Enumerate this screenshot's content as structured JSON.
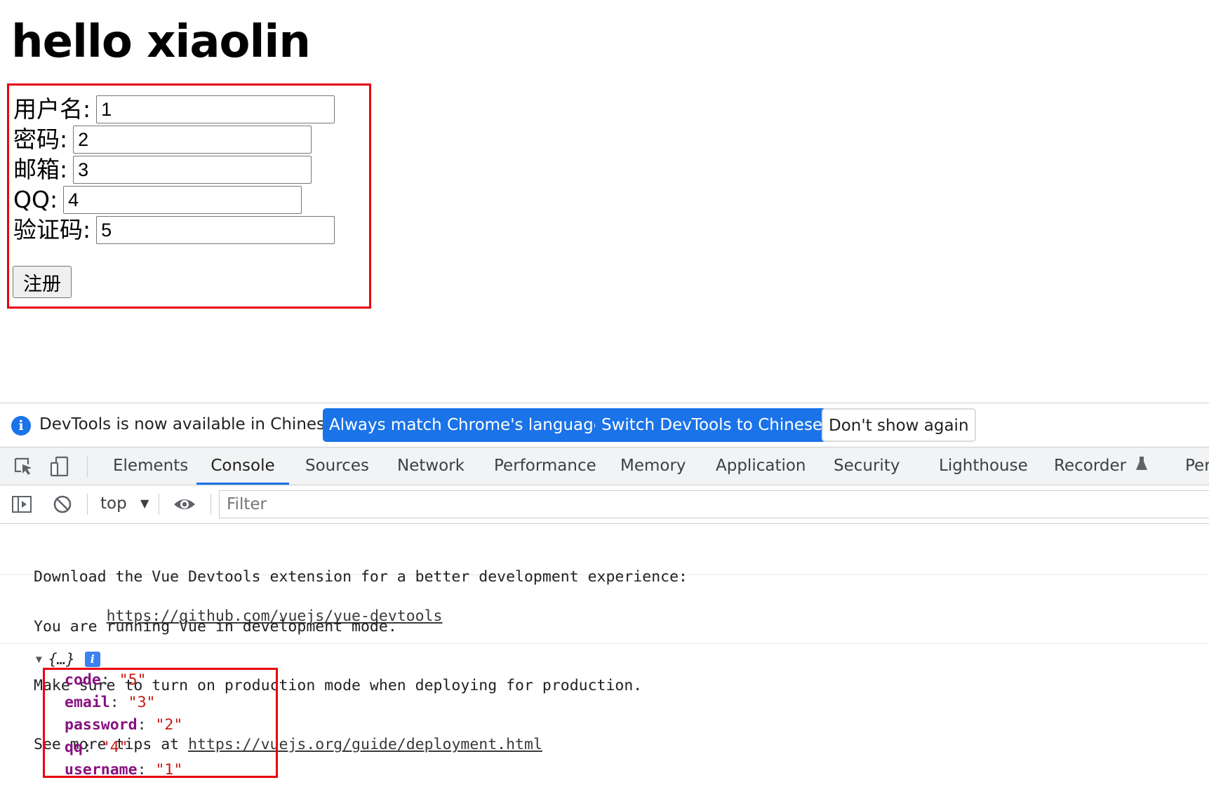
{
  "page": {
    "title": "hello xiaolin",
    "form": {
      "fields": [
        {
          "label": "用户名:",
          "value": "1"
        },
        {
          "label": "密码:",
          "value": "2"
        },
        {
          "label": "邮箱:",
          "value": "3"
        },
        {
          "label": "QQ:",
          "value": "4"
        },
        {
          "label": "验证码:",
          "value": "5"
        }
      ],
      "submit_label": "注册"
    }
  },
  "devtools": {
    "infobar": {
      "message": "DevTools is now available in Chinese!",
      "btn_match": "Always match Chrome's language",
      "btn_switch": "Switch DevTools to Chinese",
      "btn_dismiss": "Don't show again"
    },
    "tabs": [
      "Elements",
      "Console",
      "Sources",
      "Network",
      "Performance",
      "Memory",
      "Application",
      "Security",
      "Lighthouse",
      "Recorder",
      "Per"
    ],
    "active_tab": "Console",
    "toolbar": {
      "context": "top",
      "filter_placeholder": "Filter"
    },
    "console": {
      "messages": [
        {
          "lines": [
            "Download the Vue Devtools extension for a better development experience:"
          ],
          "link": "https://github.com/vuejs/vue-devtools"
        },
        {
          "lines": [
            "You are running Vue in development mode.",
            "Make sure to turn on production mode when deploying for production.",
            "See more tips at "
          ],
          "link": "https://vuejs.org/guide/deployment.html"
        }
      ],
      "object": {
        "preview": "{…}",
        "info_icon": "i",
        "props": [
          {
            "key": "code",
            "value": "\"5\""
          },
          {
            "key": "email",
            "value": "\"3\""
          },
          {
            "key": "password",
            "value": "\"2\""
          },
          {
            "key": "qq",
            "value": "\"4\""
          },
          {
            "key": "username",
            "value": "\"1\""
          }
        ]
      }
    },
    "colors": {
      "accent": "#1a73e8",
      "highlight_box": "#e8000f",
      "prop_key": "#881280",
      "prop_value": "#c41a16"
    }
  }
}
